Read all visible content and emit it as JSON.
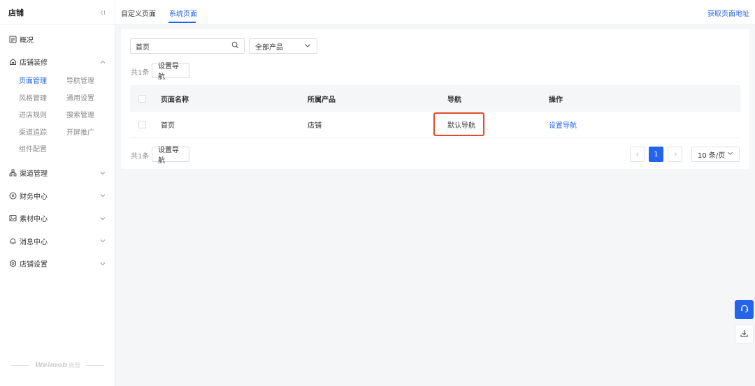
{
  "sidebar": {
    "title": "店铺",
    "items": [
      {
        "label": "概况",
        "icon": "overview-icon"
      },
      {
        "label": "店铺装修",
        "icon": "store-decor-icon"
      },
      {
        "label": "渠道管理",
        "icon": "channel-icon"
      },
      {
        "label": "财务中心",
        "icon": "finance-icon"
      },
      {
        "label": "素材中心",
        "icon": "image-icon"
      },
      {
        "label": "消息中心",
        "icon": "bell-icon"
      },
      {
        "label": "店铺设置",
        "icon": "settings-icon"
      }
    ],
    "sub_items": [
      "页面管理",
      "导航管理",
      "风格管理",
      "通用设置",
      "进店规则",
      "搜索管理",
      "渠道追踪",
      "开屏推广",
      "组件配置"
    ],
    "active_sub": "页面管理",
    "footer_brand": "Weimob",
    "footer_brand_cn": "微盟"
  },
  "topbar": {
    "tabs": [
      "自定义页面",
      "系统页面"
    ],
    "active_tab": "系统页面",
    "right_link": "获取页面地址"
  },
  "filters": {
    "search_value": "首页",
    "product_select": "全部产品"
  },
  "toolbar": {
    "count_text": "共1条",
    "set_nav_label": "设置导航"
  },
  "table": {
    "columns": [
      "页面名称",
      "所属产品",
      "导航",
      "操作"
    ],
    "rows": [
      {
        "name": "首页",
        "product": "店铺",
        "nav": "默认导航",
        "action": "设置导航"
      }
    ]
  },
  "pagination": {
    "current_page": "1",
    "page_size": "10 条/页"
  },
  "colors": {
    "accent": "#2463ec",
    "highlight": "#e04a2f"
  }
}
